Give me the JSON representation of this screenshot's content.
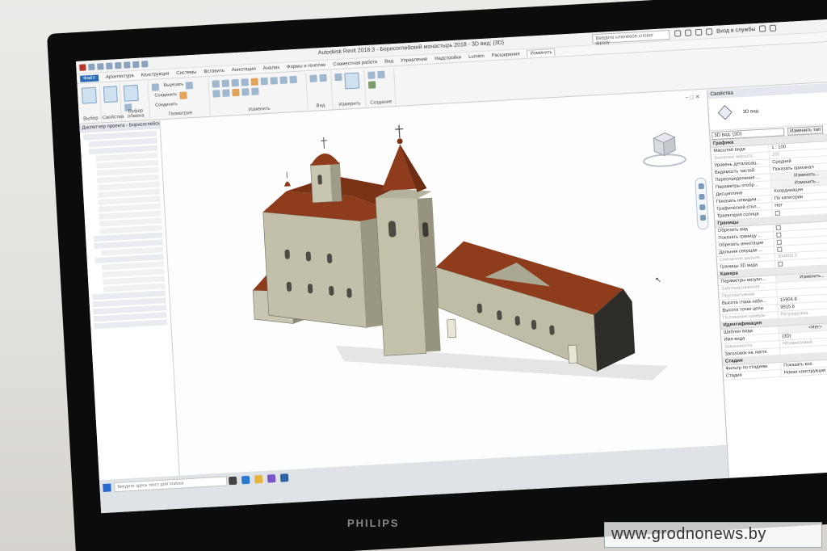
{
  "window": {
    "title": "Autodesk Revit 2018.3 -   Борисоглебский монастырь 2018 - 3D вид: {3D}",
    "search_placeholder": "Введите ключевое слово/фразу",
    "login_label": "Вход в службы"
  },
  "ribbon": {
    "tabs": [
      "Файл",
      "Архитектура",
      "Конструкция",
      "Системы",
      "Вставить",
      "Аннотации",
      "Анализ",
      "Формы и генплан",
      "Совместная работа",
      "Вид",
      "Управление",
      "Надстройки",
      "Lumion",
      "Расширения",
      "Изменить"
    ],
    "groups": [
      "Выбор",
      "Свойства",
      "Буфер обмена",
      "Геометрия",
      "Изменить",
      "Вид",
      "Измерить",
      "Создание"
    ],
    "buttons": [
      "Вырезать",
      "Соединить",
      "Соединить"
    ]
  },
  "project_browser": {
    "title": "Диспетчер проекта - Борисоглебский..."
  },
  "properties": {
    "panel_title": "Свойства",
    "type_name": "3D вид",
    "selector_value": "3D вид: {3D}",
    "edit_type_label": "Изменить тип",
    "sections": {
      "graphics": "Графика",
      "extents": "Границы",
      "camera": "Камера",
      "identity": "Идентификация",
      "phasing": "Стадии"
    },
    "graphics_rows": [
      {
        "key": "Масштаб вида",
        "value": "1 : 100"
      },
      {
        "key": "Значение масшта...",
        "value": "100"
      },
      {
        "key": "Уровень детализац...",
        "value": "Средний"
      },
      {
        "key": "Видимость частей",
        "value": "Показать оригинал"
      },
      {
        "key": "Переопределения ...",
        "value": "Изменить..."
      },
      {
        "key": "Параметры отобр...",
        "value": "Изменить..."
      },
      {
        "key": "Дисциплина",
        "value": "Координация"
      },
      {
        "key": "Показать невидим...",
        "value": "По категории"
      },
      {
        "key": "Графический стил...",
        "value": "Нет"
      },
      {
        "key": "Траектория солнца",
        "value": ""
      }
    ],
    "extents_rows": [
      {
        "key": "Обрезать вид",
        "value": ""
      },
      {
        "key": "Показать границу ...",
        "value": ""
      },
      {
        "key": "Обрезать аннотации",
        "value": ""
      },
      {
        "key": "Дальняя секущая ...",
        "value": ""
      },
      {
        "key": "Смещение дальне...",
        "value": "304800.0"
      },
      {
        "key": "Границы 3D вида",
        "value": ""
      }
    ],
    "camera_rows": [
      {
        "key": "Параметры визуал...",
        "value": "Изменить..."
      },
      {
        "key": "Заблокированная ...",
        "value": ""
      },
      {
        "key": "Перспективная",
        "value": ""
      },
      {
        "key": "Высота глаза набл...",
        "value": "15904.8"
      },
      {
        "key": "Высота точки цели",
        "value": "9915.6"
      },
      {
        "key": "Положение камеры",
        "value": "Регулировка"
      }
    ],
    "identity_rows": [
      {
        "key": "Шаблон вида",
        "value": "<Нет>"
      },
      {
        "key": "Имя вида",
        "value": "{3D}"
      },
      {
        "key": "Зависимость",
        "value": "Независимый"
      },
      {
        "key": "Заголовок на листе",
        "value": ""
      }
    ],
    "phasing_rows": [
      {
        "key": "Фильтр по стадиям",
        "value": "Показать все"
      },
      {
        "key": "Стадия",
        "value": "Новая конструкция"
      }
    ]
  },
  "taskbar": {
    "search_placeholder": "Введите здесь текст для поиска"
  },
  "monitor_brand": "PHILIPS",
  "watermark": "www.grodnonews.by",
  "colors": {
    "roof": "#8e3c1c",
    "walls": "#b9b6a3",
    "file_tab": "#2a6cb3"
  }
}
